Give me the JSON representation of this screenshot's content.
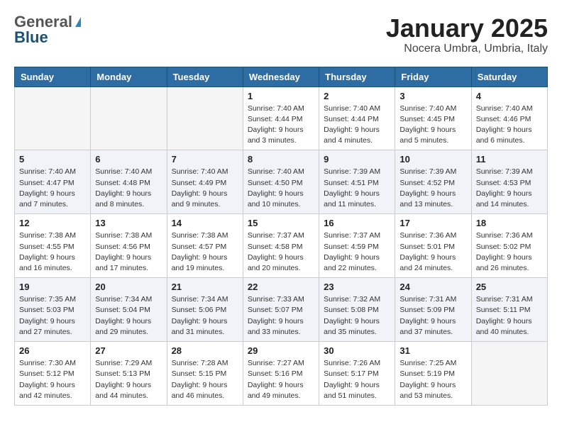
{
  "header": {
    "logo_general": "General",
    "logo_blue": "Blue",
    "month_title": "January 2025",
    "location": "Nocera Umbra, Umbria, Italy"
  },
  "weekdays": [
    "Sunday",
    "Monday",
    "Tuesday",
    "Wednesday",
    "Thursday",
    "Friday",
    "Saturday"
  ],
  "weeks": [
    [
      {
        "day": "",
        "info": ""
      },
      {
        "day": "",
        "info": ""
      },
      {
        "day": "",
        "info": ""
      },
      {
        "day": "1",
        "info": "Sunrise: 7:40 AM\nSunset: 4:44 PM\nDaylight: 9 hours and 3 minutes."
      },
      {
        "day": "2",
        "info": "Sunrise: 7:40 AM\nSunset: 4:44 PM\nDaylight: 9 hours and 4 minutes."
      },
      {
        "day": "3",
        "info": "Sunrise: 7:40 AM\nSunset: 4:45 PM\nDaylight: 9 hours and 5 minutes."
      },
      {
        "day": "4",
        "info": "Sunrise: 7:40 AM\nSunset: 4:46 PM\nDaylight: 9 hours and 6 minutes."
      }
    ],
    [
      {
        "day": "5",
        "info": "Sunrise: 7:40 AM\nSunset: 4:47 PM\nDaylight: 9 hours and 7 minutes."
      },
      {
        "day": "6",
        "info": "Sunrise: 7:40 AM\nSunset: 4:48 PM\nDaylight: 9 hours and 8 minutes."
      },
      {
        "day": "7",
        "info": "Sunrise: 7:40 AM\nSunset: 4:49 PM\nDaylight: 9 hours and 9 minutes."
      },
      {
        "day": "8",
        "info": "Sunrise: 7:40 AM\nSunset: 4:50 PM\nDaylight: 9 hours and 10 minutes."
      },
      {
        "day": "9",
        "info": "Sunrise: 7:39 AM\nSunset: 4:51 PM\nDaylight: 9 hours and 11 minutes."
      },
      {
        "day": "10",
        "info": "Sunrise: 7:39 AM\nSunset: 4:52 PM\nDaylight: 9 hours and 13 minutes."
      },
      {
        "day": "11",
        "info": "Sunrise: 7:39 AM\nSunset: 4:53 PM\nDaylight: 9 hours and 14 minutes."
      }
    ],
    [
      {
        "day": "12",
        "info": "Sunrise: 7:38 AM\nSunset: 4:55 PM\nDaylight: 9 hours and 16 minutes."
      },
      {
        "day": "13",
        "info": "Sunrise: 7:38 AM\nSunset: 4:56 PM\nDaylight: 9 hours and 17 minutes."
      },
      {
        "day": "14",
        "info": "Sunrise: 7:38 AM\nSunset: 4:57 PM\nDaylight: 9 hours and 19 minutes."
      },
      {
        "day": "15",
        "info": "Sunrise: 7:37 AM\nSunset: 4:58 PM\nDaylight: 9 hours and 20 minutes."
      },
      {
        "day": "16",
        "info": "Sunrise: 7:37 AM\nSunset: 4:59 PM\nDaylight: 9 hours and 22 minutes."
      },
      {
        "day": "17",
        "info": "Sunrise: 7:36 AM\nSunset: 5:01 PM\nDaylight: 9 hours and 24 minutes."
      },
      {
        "day": "18",
        "info": "Sunrise: 7:36 AM\nSunset: 5:02 PM\nDaylight: 9 hours and 26 minutes."
      }
    ],
    [
      {
        "day": "19",
        "info": "Sunrise: 7:35 AM\nSunset: 5:03 PM\nDaylight: 9 hours and 27 minutes."
      },
      {
        "day": "20",
        "info": "Sunrise: 7:34 AM\nSunset: 5:04 PM\nDaylight: 9 hours and 29 minutes."
      },
      {
        "day": "21",
        "info": "Sunrise: 7:34 AM\nSunset: 5:06 PM\nDaylight: 9 hours and 31 minutes."
      },
      {
        "day": "22",
        "info": "Sunrise: 7:33 AM\nSunset: 5:07 PM\nDaylight: 9 hours and 33 minutes."
      },
      {
        "day": "23",
        "info": "Sunrise: 7:32 AM\nSunset: 5:08 PM\nDaylight: 9 hours and 35 minutes."
      },
      {
        "day": "24",
        "info": "Sunrise: 7:31 AM\nSunset: 5:09 PM\nDaylight: 9 hours and 37 minutes."
      },
      {
        "day": "25",
        "info": "Sunrise: 7:31 AM\nSunset: 5:11 PM\nDaylight: 9 hours and 40 minutes."
      }
    ],
    [
      {
        "day": "26",
        "info": "Sunrise: 7:30 AM\nSunset: 5:12 PM\nDaylight: 9 hours and 42 minutes."
      },
      {
        "day": "27",
        "info": "Sunrise: 7:29 AM\nSunset: 5:13 PM\nDaylight: 9 hours and 44 minutes."
      },
      {
        "day": "28",
        "info": "Sunrise: 7:28 AM\nSunset: 5:15 PM\nDaylight: 9 hours and 46 minutes."
      },
      {
        "day": "29",
        "info": "Sunrise: 7:27 AM\nSunset: 5:16 PM\nDaylight: 9 hours and 49 minutes."
      },
      {
        "day": "30",
        "info": "Sunrise: 7:26 AM\nSunset: 5:17 PM\nDaylight: 9 hours and 51 minutes."
      },
      {
        "day": "31",
        "info": "Sunrise: 7:25 AM\nSunset: 5:19 PM\nDaylight: 9 hours and 53 minutes."
      },
      {
        "day": "",
        "info": ""
      }
    ]
  ]
}
